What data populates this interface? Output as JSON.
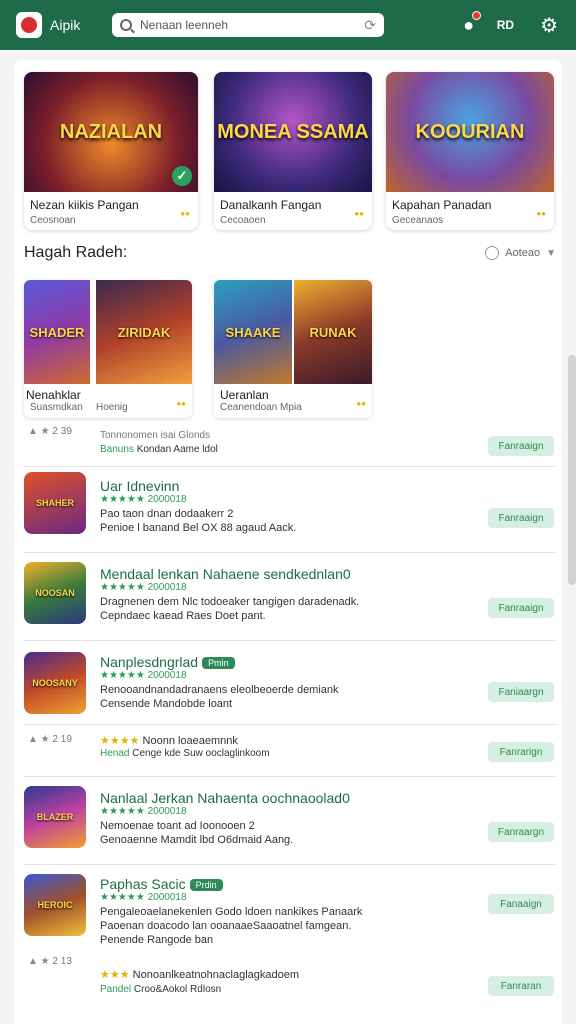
{
  "header": {
    "app_name": "Aipik",
    "search_value": "Nenaan leenneh",
    "right_text": "RD"
  },
  "featured": [
    {
      "art": "NAZIALAN",
      "title": "Nezan kiikis Pangan",
      "sub": "Ceosnoan",
      "checked": true
    },
    {
      "art": "MONEA SSAMA",
      "title": "Danalkanh Fangan",
      "sub": "Cecoaoen",
      "checked": false
    },
    {
      "art": "KOOURIAN",
      "title": "Kapahan Panadan",
      "sub": "Geceanaos",
      "checked": false
    }
  ],
  "section": {
    "title": "Hagah Radeh:",
    "sort_label": "Aoteao"
  },
  "grid": [
    {
      "art": "SHADER",
      "title": "Nenahklar",
      "sub": "Suasmdkan"
    },
    {
      "art": "ZIRIDAK",
      "title": "",
      "sub": "Hoenig"
    },
    {
      "art": "SHAAKE",
      "title": "Ueranlan",
      "sub": "Ceanendoan Mpia"
    },
    {
      "art": "RUNAK",
      "title": "",
      "sub": ""
    }
  ],
  "meta1": {
    "rating": "2 39",
    "line1": "Tonnonomen isai Glonds",
    "line2_green": "Banuns",
    "line2": "Kondan Aame ldol",
    "button": "Fanraaign"
  },
  "list": [
    {
      "art": "SHAHER",
      "title": "Uar Idnevinn",
      "tag": "",
      "stars": "★★★★★ 2000018",
      "line1": "Pao taon dnan dodaakerr 2",
      "line2": "Penioe l banand Bel OX 88 agaud Aack.",
      "button": "Fanraaign"
    },
    {
      "art": "NOOSAN",
      "title": "Mendaal lenkan Nahaene sendkednlan0",
      "tag": "",
      "stars": "★★★★★ 2000018",
      "line1": "Dragnenen dem Nlc todoeaker tangigen daradenadk.",
      "line2": "Cepndaec kaead Raes Doet pant.",
      "button": "Fanraaign"
    },
    {
      "art": "NOOSANY",
      "title": "Nanplesdngrlad",
      "tag": "Pmin",
      "stars": "★★★★★ 2000018",
      "line1": "Renooandnandadranaens eleolbeoerde demiank",
      "line2": "Censende Mandobde loant",
      "button": "Faniaargn"
    }
  ],
  "meta2": {
    "rating": "2 19",
    "line1_stars": "★★★★",
    "line1": "Noonn loaeaemnnk",
    "line2_green": "Henad",
    "line2": "Cenge kde Suw ooclaglinkoom",
    "button": "Fanrarign"
  },
  "list2": [
    {
      "art": "BLAZER",
      "title": "Nanlaal Jerkan Nahaenta oochnaoolad0",
      "tag": "",
      "stars": "★★★★★ 2000018",
      "line1": "Nemoenae toant ad Ioonooen 2",
      "line2": "Genoaenne Mamdit lbd O6dmaid Aang.",
      "button": "Fanraargn"
    },
    {
      "art": "HEROIC",
      "title": "Paphas Sacic",
      "tag": "Prdin",
      "stars": "★★★★★ 2000018",
      "line1": "Pengaleoaelanekenlen Godo ldoen nankikes Panaark",
      "line2": "Paoenan doacodo lan ooanaaeSaaoatnel famgean.",
      "line3": "Penende Rangode ban",
      "button": "Fanaaign"
    }
  ],
  "meta3": {
    "rating": "2 13",
    "line1_stars": "★★★",
    "line1": "Nonoanlkeatnohnaclaglagkadoem",
    "line2_green": "Pandel",
    "line2": "Croo&Aokol Rdlosn",
    "button": "Fanraran"
  }
}
